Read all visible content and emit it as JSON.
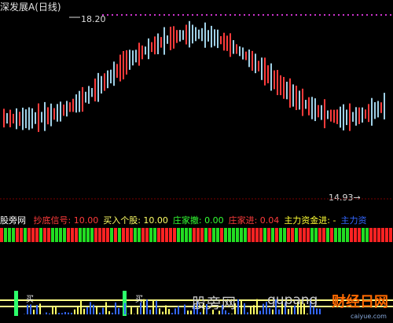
{
  "window": {
    "title": "深发展A(日线)"
  },
  "price_chart": {
    "high_label": "18.20",
    "low_label": "14.93→",
    "colors": {
      "up": "#ff3b3b",
      "down": "#9fd0e6",
      "neutral": "#ffffff",
      "dots": "#cc33cc"
    }
  },
  "indicator": {
    "name": "股旁网",
    "items": [
      {
        "label": "抄底信号:",
        "value": "10.00",
        "color": "#ff3b3b"
      },
      {
        "label": "买入个股:",
        "value": "10.00",
        "color": "#ffff66"
      },
      {
        "label": "庄家撤:",
        "value": "0.00",
        "color": "#33ff33"
      },
      {
        "label": "庄家进:",
        "value": "0.04",
        "color": "#ff3b3b"
      },
      {
        "label": "主力资金进:",
        "value": "-",
        "color": "#ffff33"
      },
      {
        "label": "主力资",
        "value": "",
        "color": "#3366ff"
      }
    ]
  },
  "bottom_panel": {
    "buy_mark": "买"
  },
  "watermark": {
    "text": "股旁网",
    "url": "gupang",
    "logo_text": "财经日网",
    "logo_sub": "caiyue.com"
  }
}
